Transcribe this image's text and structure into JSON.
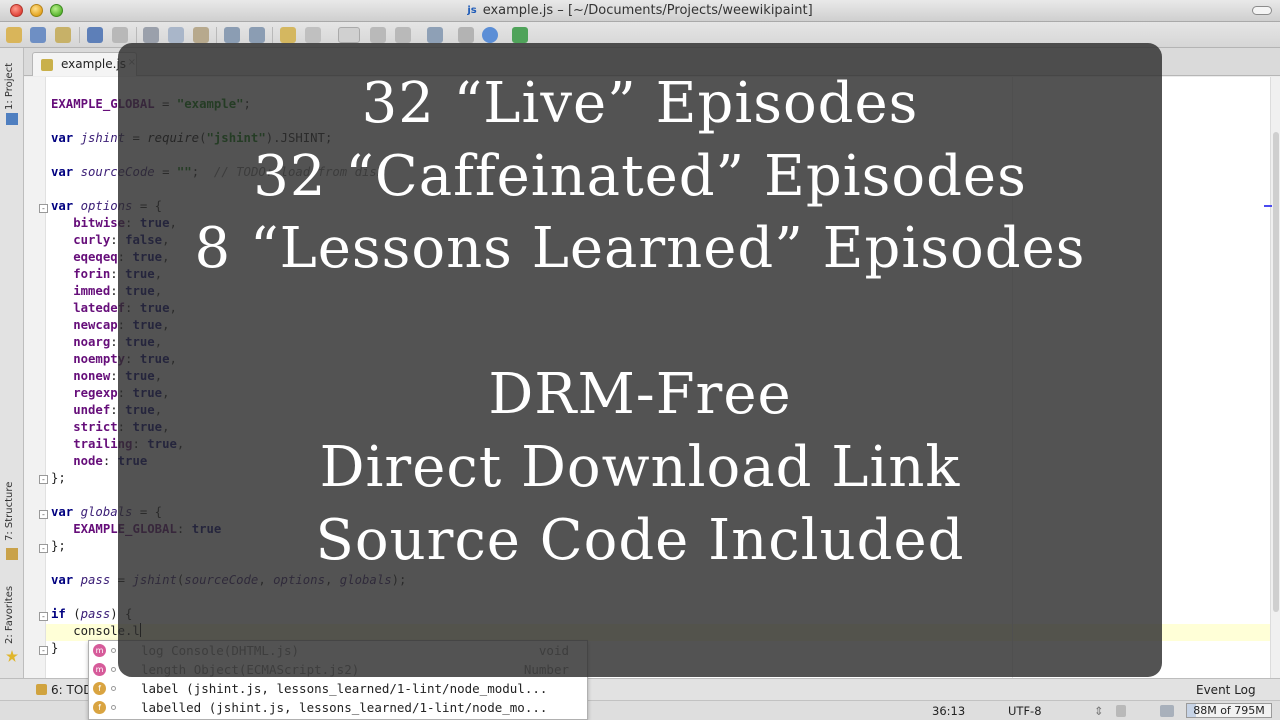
{
  "window": {
    "title": "example.js – [~/Documents/Projects/weewikipaint]",
    "file_badge": "js"
  },
  "left_tools": {
    "project": "1: Project",
    "structure": "7: Structure",
    "favorites": "2: Favorites"
  },
  "editor": {
    "tab_label": "example.js",
    "tab_close": "×"
  },
  "code_lines": [
    {
      "segments": [
        {
          "t": "EXAMPLE_GLOBAL",
          "c": "glob"
        },
        {
          "t": " = ",
          "c": ""
        },
        {
          "t": "\"example\"",
          "c": "str"
        },
        {
          "t": ";",
          "c": ""
        }
      ]
    },
    {
      "segments": []
    },
    {
      "segments": [
        {
          "t": "var ",
          "c": "kw"
        },
        {
          "t": "jshint",
          "c": "vr"
        },
        {
          "t": " = ",
          "c": ""
        },
        {
          "t": "require",
          "c": "fn"
        },
        {
          "t": "(",
          "c": ""
        },
        {
          "t": "\"jshint\"",
          "c": "str"
        },
        {
          "t": ").JSHINT;",
          "c": ""
        }
      ]
    },
    {
      "segments": []
    },
    {
      "segments": [
        {
          "t": "var ",
          "c": "kw"
        },
        {
          "t": "sourceCode",
          "c": "vr"
        },
        {
          "t": " = ",
          "c": ""
        },
        {
          "t": "\"\"",
          "c": "str"
        },
        {
          "t": ";  ",
          "c": ""
        },
        {
          "t": "// TODO: load from disk",
          "c": "cm"
        }
      ]
    },
    {
      "segments": []
    },
    {
      "segments": [
        {
          "t": "var ",
          "c": "kw"
        },
        {
          "t": "options",
          "c": "vr"
        },
        {
          "t": " = {",
          "c": ""
        }
      ]
    },
    {
      "segments": [
        {
          "t": "   ",
          "c": ""
        },
        {
          "t": "bitwise",
          "c": "prop"
        },
        {
          "t": ": ",
          "c": ""
        },
        {
          "t": "true",
          "c": "kw"
        },
        {
          "t": ",",
          "c": ""
        }
      ]
    },
    {
      "segments": [
        {
          "t": "   ",
          "c": ""
        },
        {
          "t": "curly",
          "c": "prop"
        },
        {
          "t": ": ",
          "c": ""
        },
        {
          "t": "false",
          "c": "kw"
        },
        {
          "t": ",",
          "c": ""
        }
      ]
    },
    {
      "segments": [
        {
          "t": "   ",
          "c": ""
        },
        {
          "t": "eqeqeq",
          "c": "prop"
        },
        {
          "t": ": ",
          "c": ""
        },
        {
          "t": "true",
          "c": "kw"
        },
        {
          "t": ",",
          "c": ""
        }
      ]
    },
    {
      "segments": [
        {
          "t": "   ",
          "c": ""
        },
        {
          "t": "forin",
          "c": "prop"
        },
        {
          "t": ": ",
          "c": ""
        },
        {
          "t": "true",
          "c": "kw"
        },
        {
          "t": ",",
          "c": ""
        }
      ]
    },
    {
      "segments": [
        {
          "t": "   ",
          "c": ""
        },
        {
          "t": "immed",
          "c": "prop"
        },
        {
          "t": ": ",
          "c": ""
        },
        {
          "t": "true",
          "c": "kw"
        },
        {
          "t": ",",
          "c": ""
        }
      ]
    },
    {
      "segments": [
        {
          "t": "   ",
          "c": ""
        },
        {
          "t": "latedef",
          "c": "prop"
        },
        {
          "t": ": ",
          "c": ""
        },
        {
          "t": "true",
          "c": "kw"
        },
        {
          "t": ",",
          "c": ""
        }
      ]
    },
    {
      "segments": [
        {
          "t": "   ",
          "c": ""
        },
        {
          "t": "newcap",
          "c": "prop"
        },
        {
          "t": ": ",
          "c": ""
        },
        {
          "t": "true",
          "c": "kw"
        },
        {
          "t": ",",
          "c": ""
        }
      ]
    },
    {
      "segments": [
        {
          "t": "   ",
          "c": ""
        },
        {
          "t": "noarg",
          "c": "prop"
        },
        {
          "t": ": ",
          "c": ""
        },
        {
          "t": "true",
          "c": "kw"
        },
        {
          "t": ",",
          "c": ""
        }
      ]
    },
    {
      "segments": [
        {
          "t": "   ",
          "c": ""
        },
        {
          "t": "noempty",
          "c": "prop"
        },
        {
          "t": ": ",
          "c": ""
        },
        {
          "t": "true",
          "c": "kw"
        },
        {
          "t": ",",
          "c": ""
        }
      ]
    },
    {
      "segments": [
        {
          "t": "   ",
          "c": ""
        },
        {
          "t": "nonew",
          "c": "prop"
        },
        {
          "t": ": ",
          "c": ""
        },
        {
          "t": "true",
          "c": "kw"
        },
        {
          "t": ",",
          "c": ""
        }
      ]
    },
    {
      "segments": [
        {
          "t": "   ",
          "c": ""
        },
        {
          "t": "regexp",
          "c": "prop"
        },
        {
          "t": ": ",
          "c": ""
        },
        {
          "t": "true",
          "c": "kw"
        },
        {
          "t": ",",
          "c": ""
        }
      ]
    },
    {
      "segments": [
        {
          "t": "   ",
          "c": ""
        },
        {
          "t": "undef",
          "c": "prop"
        },
        {
          "t": ": ",
          "c": ""
        },
        {
          "t": "true",
          "c": "kw"
        },
        {
          "t": ",",
          "c": ""
        }
      ]
    },
    {
      "segments": [
        {
          "t": "   ",
          "c": ""
        },
        {
          "t": "strict",
          "c": "prop"
        },
        {
          "t": ": ",
          "c": ""
        },
        {
          "t": "true",
          "c": "kw"
        },
        {
          "t": ",",
          "c": ""
        }
      ]
    },
    {
      "segments": [
        {
          "t": "   ",
          "c": ""
        },
        {
          "t": "trailing",
          "c": "prop"
        },
        {
          "t": ": ",
          "c": ""
        },
        {
          "t": "true",
          "c": "kw"
        },
        {
          "t": ",",
          "c": ""
        }
      ]
    },
    {
      "segments": [
        {
          "t": "   ",
          "c": ""
        },
        {
          "t": "node",
          "c": "prop"
        },
        {
          "t": ": ",
          "c": ""
        },
        {
          "t": "true",
          "c": "kw"
        }
      ]
    },
    {
      "segments": [
        {
          "t": "};",
          "c": ""
        }
      ]
    },
    {
      "segments": []
    },
    {
      "segments": [
        {
          "t": "var ",
          "c": "kw"
        },
        {
          "t": "globals",
          "c": "vr"
        },
        {
          "t": " = {",
          "c": ""
        }
      ]
    },
    {
      "segments": [
        {
          "t": "   ",
          "c": ""
        },
        {
          "t": "EXAMPLE_GLOBAL",
          "c": "prop"
        },
        {
          "t": ": ",
          "c": ""
        },
        {
          "t": "true",
          "c": "kw"
        }
      ]
    },
    {
      "segments": [
        {
          "t": "};",
          "c": ""
        }
      ]
    },
    {
      "segments": []
    },
    {
      "segments": [
        {
          "t": "var ",
          "c": "kw"
        },
        {
          "t": "pass",
          "c": "vr"
        },
        {
          "t": " = ",
          "c": ""
        },
        {
          "t": "jshint",
          "c": "vr"
        },
        {
          "t": "(",
          "c": ""
        },
        {
          "t": "sourceCode",
          "c": "vr"
        },
        {
          "t": ", ",
          "c": ""
        },
        {
          "t": "options",
          "c": "vr"
        },
        {
          "t": ", ",
          "c": ""
        },
        {
          "t": "globals",
          "c": "vr"
        },
        {
          "t": ");",
          "c": ""
        }
      ]
    },
    {
      "segments": []
    },
    {
      "segments": [
        {
          "t": "if ",
          "c": "kw"
        },
        {
          "t": "(",
          "c": ""
        },
        {
          "t": "pass",
          "c": "vr"
        },
        {
          "t": ") {",
          "c": ""
        }
      ]
    },
    {
      "segments": [
        {
          "t": "   console.l",
          "c": ""
        }
      ],
      "caret": true
    },
    {
      "segments": [
        {
          "t": "}",
          "c": ""
        }
      ]
    }
  ],
  "completion": [
    {
      "icon": "m",
      "name": "log",
      "detail": "Console(DHTML.js)",
      "type": "void",
      "dim": true
    },
    {
      "icon": "m",
      "name": "length",
      "detail": "Object(ECMAScript.js2)",
      "type": "Number",
      "dim": true
    },
    {
      "icon": "f",
      "name": "label",
      "detail": "(jshint.js, lessons_learned/1-lint/node_modul...",
      "type": "",
      "dim": false
    },
    {
      "icon": "f",
      "name": "labelled",
      "detail": "(jshint.js, lessons_learned/1-lint/node_mo...",
      "type": "",
      "dim": false
    }
  ],
  "bottom_tools": {
    "todo": "6: TODO",
    "event_log": "Event Log"
  },
  "status": {
    "position": "36:13",
    "encoding": "UTF-8",
    "memory": "88M of 795M",
    "memory_fraction": 0.11
  },
  "overlay": {
    "lines": [
      "32 “Live” Episodes",
      "32 “Caffeinated” Episodes",
      "8 “Lessons Learned” Episodes",
      "DRM-Free",
      "Direct Download Link",
      "Source Code Included"
    ]
  },
  "colors": {
    "keyword": "#000080",
    "string": "#008000",
    "property": "#660e7a",
    "comment": "#808080",
    "overlay_bg": "#2d2d2d",
    "current_line": "#ffffd7"
  }
}
